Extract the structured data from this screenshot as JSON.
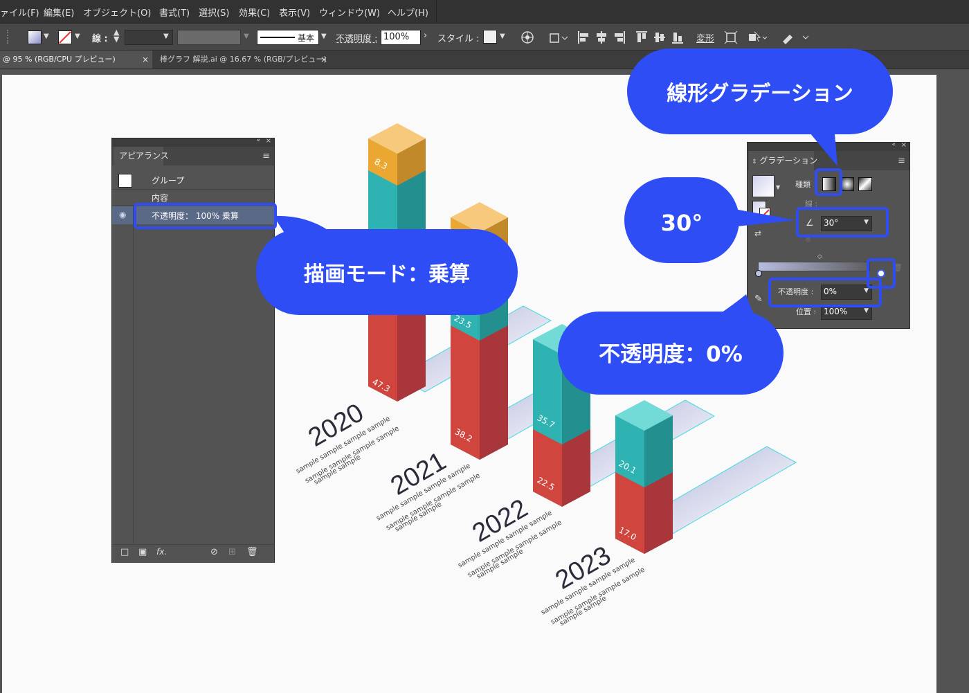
{
  "menu": [
    "ァイル(F)",
    "編集(E)",
    "オブジェクト(O)",
    "書式(T)",
    "選択(S)",
    "効果(C)",
    "表示(V)",
    "ウィンドウ(W)",
    "ヘルプ(H)"
  ],
  "controlbar": {
    "stroke_label": "線 :",
    "stroke_style": "基本",
    "opacity_label": "不透明度 :",
    "opacity_value": "100%",
    "style_label": "スタイル :",
    "transform_label": "変形"
  },
  "tabs": [
    {
      "label": "@ 95 % (RGB/CPU プレビュー)",
      "close": "×"
    },
    {
      "label": "棒グラフ 解説.ai @ 16.67 % (RGB/プレビュー)",
      "close": "×"
    }
  ],
  "appearance_panel": {
    "title": "アピアランス",
    "group_label": "グループ",
    "contents_label": "内容",
    "opacity_row": "不透明度：  100% 乗算"
  },
  "gradient_panel": {
    "title": "グラデーション",
    "type_label": "種類",
    "stroke_label": "線 :",
    "angle_value": "30°",
    "opacity_label": "不透明度 :",
    "opacity_value": "0%",
    "position_label": "位置 :",
    "position_value": "100%"
  },
  "callouts": {
    "blend_mode": "描画モード：乗算",
    "linear_gradient": "線形グラデーション",
    "angle": "30°",
    "opacity": "不透明度：0%"
  },
  "chart": {
    "bars": [
      {
        "year": "2020",
        "red": "47.3",
        "teal": "",
        "top": "8.3"
      },
      {
        "year": "2021",
        "red": "38.2",
        "teal": "23.5",
        "top": ""
      },
      {
        "year": "2022",
        "red": "22.5",
        "teal": "35.7",
        "top": ""
      },
      {
        "year": "2023",
        "red": "17.0",
        "teal": "20.1",
        "top": ""
      }
    ],
    "sample_text": [
      "sample sample sample sample",
      "sample sample sample sample",
      "sample sample"
    ]
  },
  "colors": {
    "accent": "#2e4df5",
    "red": "#d0463f",
    "teal": "#2fb3b2",
    "orange": "#eaa833"
  }
}
